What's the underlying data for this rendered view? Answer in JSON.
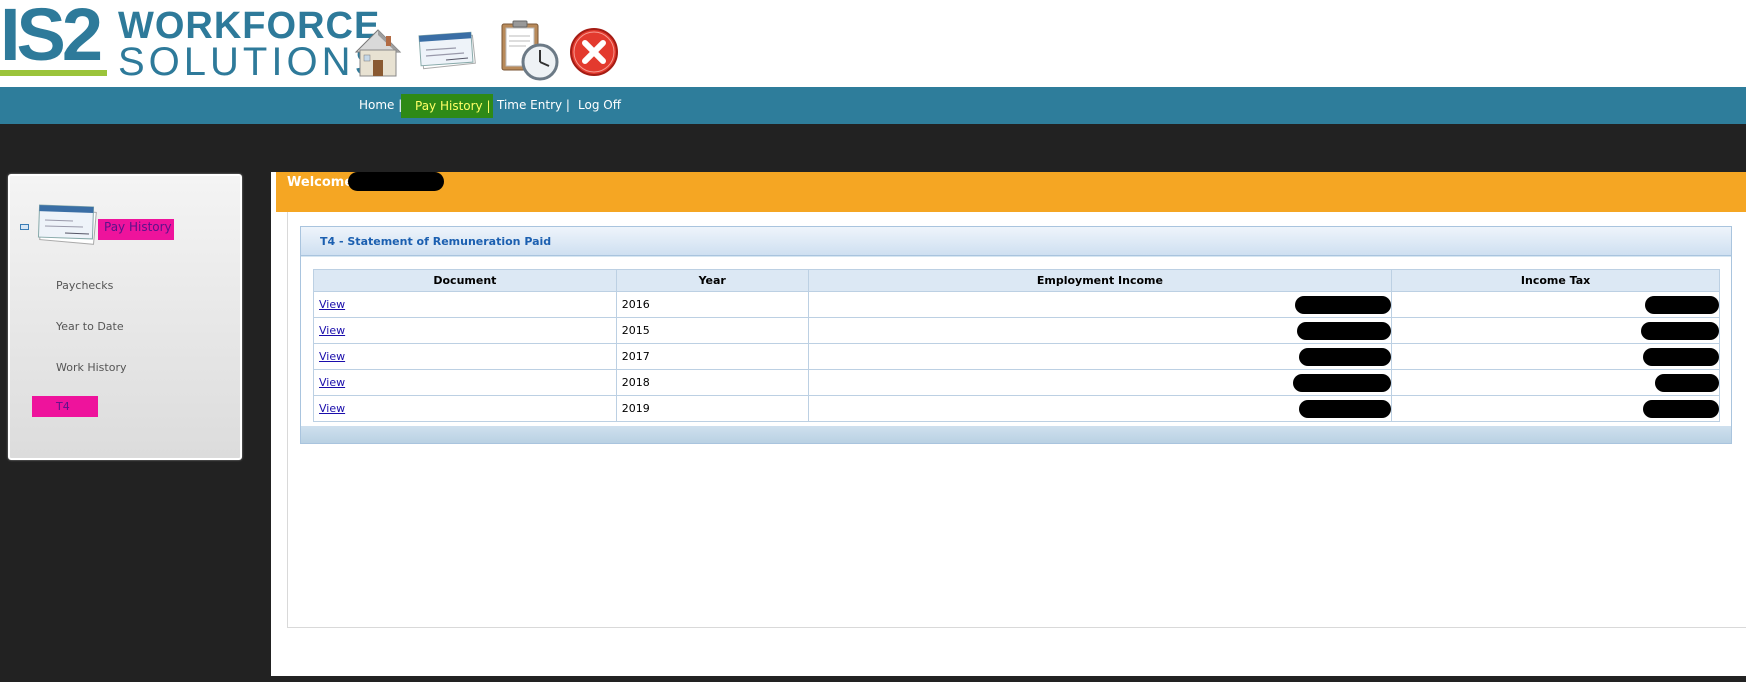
{
  "brand": {
    "logo_mark": "IS2",
    "logo_line1": "WORKFORCE",
    "logo_line2": "SOLUTIONS"
  },
  "header_icons": [
    "home-icon",
    "cheque-icon",
    "timesheet-clock-icon",
    "close-icon"
  ],
  "nav": {
    "items": [
      {
        "label": "Home |"
      },
      {
        "label": "Pay History |",
        "active": true
      },
      {
        "label": "Time Entry |"
      },
      {
        "label": "Log Off"
      }
    ]
  },
  "sidebar": {
    "title": "Pay History",
    "items": [
      {
        "label": "Paychecks"
      },
      {
        "label": "Year to Date"
      },
      {
        "label": "Work History"
      },
      {
        "label": "T4",
        "active": true
      }
    ]
  },
  "welcome": {
    "text": "Welcome"
  },
  "panel": {
    "title": "T4 - Statement of Remuneration Paid",
    "columns": [
      "Document",
      "Year",
      "Employment Income",
      "Income Tax"
    ],
    "rows": [
      {
        "document": "View",
        "year": "2016"
      },
      {
        "document": "View",
        "year": "2015"
      },
      {
        "document": "View",
        "year": "2017"
      },
      {
        "document": "View",
        "year": "2018"
      },
      {
        "document": "View",
        "year": "2019"
      }
    ]
  },
  "colors": {
    "brand_blue": "#2e7a9a",
    "nav_bar": "#2e7d9b",
    "nav_active_bg": "#2e8a16",
    "nav_active_text": "#ffff66",
    "welcome_bar": "#f5a623",
    "highlight_pink": "#ee139c",
    "background_dark": "#222222"
  }
}
